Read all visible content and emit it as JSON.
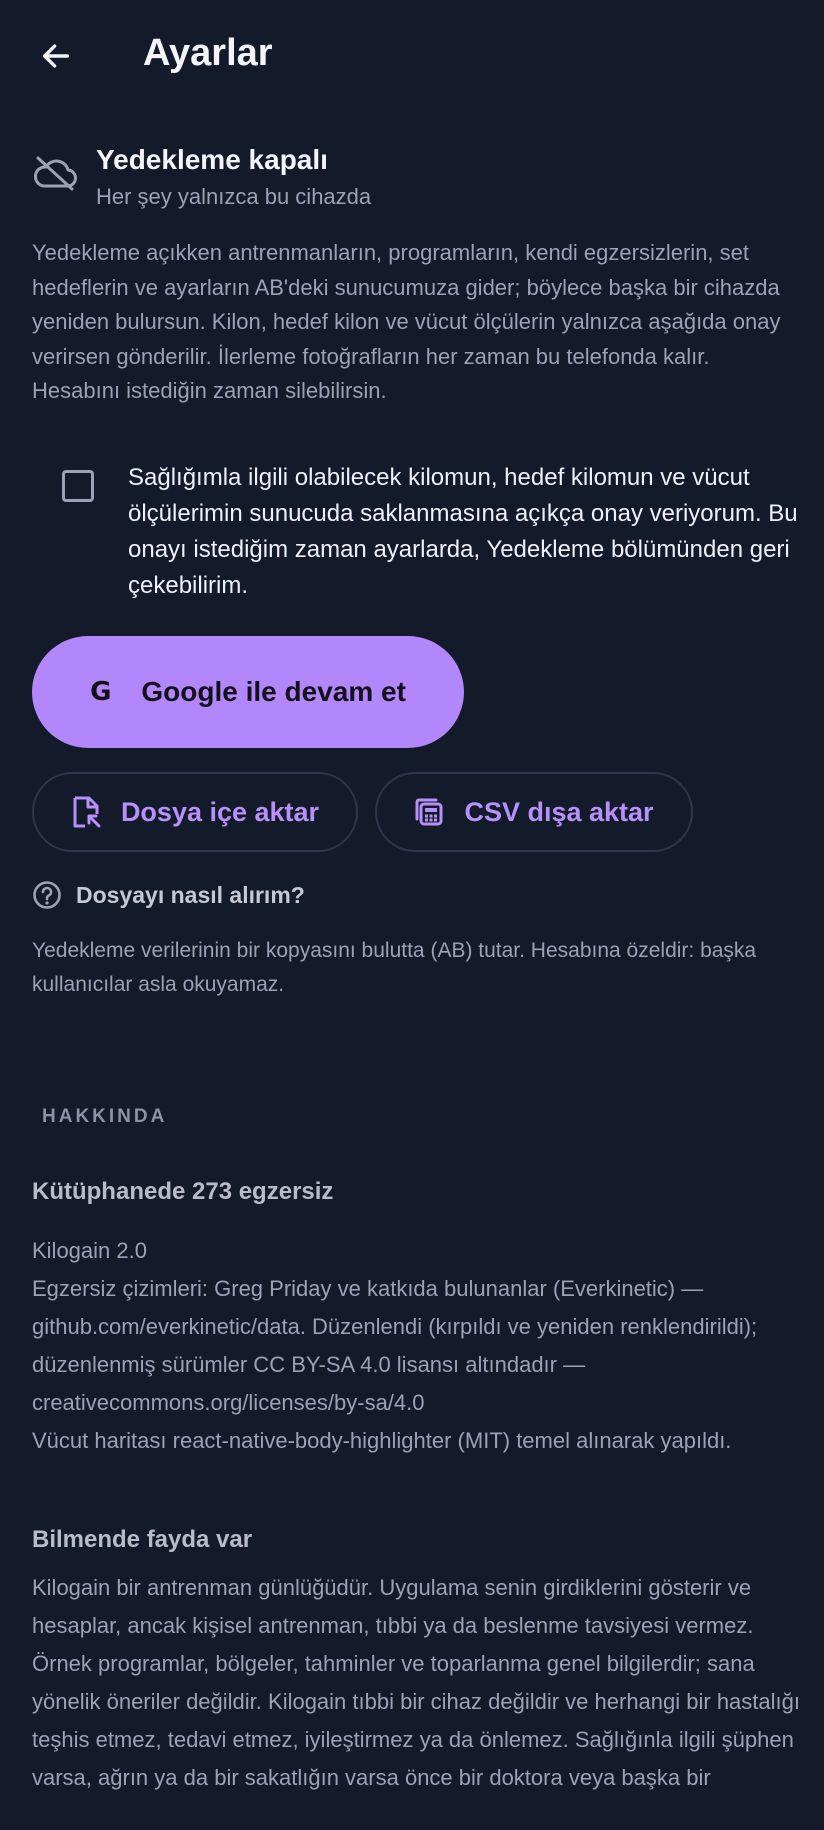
{
  "header": {
    "title": "Ayarlar",
    "back_icon": "arrow-left-icon"
  },
  "backup": {
    "status_icon": "cloud-off-icon",
    "status_title": "Yedekleme kapalı",
    "status_subtitle": "Her şey yalnızca bu cihazda",
    "description": "Yedekleme açıkken antrenmanların, programların, kendi egzersizlerin, set hedeflerin ve ayarların AB'deki sunucumuza gider; böylece başka bir cihazda yeniden bulursun. Kilon, hedef kilon ve vücut ölçülerin yalnızca aşağıda onay verirsen gönderilir. İlerleme fotoğrafların her zaman bu telefonda kalır. Hesabını istediğin zaman silebilirsin.",
    "consent_checked": false,
    "consent_text": "Sağlığımla ilgili olabilecek kilomun, hedef kilomun ve vücut ölçülerimin sunucuda saklanmasına açıkça onay veriyorum. Bu onayı istediğim zaman ayarlarda, Yedekleme bölümünden geri çekebilirim.",
    "google_button": "Google ile devam et",
    "import_button": "Dosya içe aktar",
    "export_button": "CSV dışa aktar",
    "howto_link": "Dosyayı nasıl alırım?",
    "cloud_note": "Yedekleme verilerinin bir kopyasını bulutta (AB) tutar. Hesabına özeldir: başka kullanıcılar asla okuyamaz."
  },
  "about": {
    "section_label": "HAKKINDA",
    "library_title": "Kütüphanede 273 egzersiz",
    "version": "Kilogain 2.0",
    "credits": "Egzersiz çizimleri: Greg Priday ve katkıda bulunanlar (Everkinetic) — github.com/everkinetic/data. Düzenlendi (kırpıldı ve yeniden renklendirildi); düzenlenmiş sürümler CC BY-SA 4.0 lisansı altındadır — creativecommons.org/licenses/by-sa/4.0",
    "body_map": "Vücut haritası react-native-body-highlighter (MIT) temel alınarak yapıldı.",
    "disclaimer_title": "Bilmende fayda var",
    "disclaimer": "Kilogain bir antrenman günlüğüdür. Uygulama senin girdiklerini gösterir ve hesaplar, ancak kişisel antrenman, tıbbi ya da beslenme tavsiyesi vermez. Örnek programlar, bölgeler, tahminler ve toparlanma genel bilgilerdir; sana yönelik öneriler değildir. Kilogain tıbbi bir cihaz değildir ve herhangi bir hastalığı teşhis etmez, tedavi etmez, iyileştirmez ya da önlemez. Sağlığınla ilgili şüphen varsa, ağrın ya da bir sakatlığın varsa önce bir doktora veya başka bir"
  },
  "colors": {
    "background": "#131a29",
    "accent": "#b287fb",
    "muted_text": "#9aa3b4"
  }
}
